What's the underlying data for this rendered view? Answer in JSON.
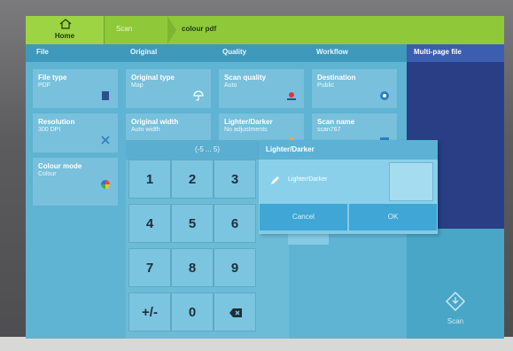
{
  "topbar": {
    "home_label": "Home",
    "crumb_scan": "Scan",
    "crumb_current": "colour pdf"
  },
  "columns": {
    "file": "File",
    "original": "Original",
    "quality": "Quality",
    "workflow": "Workflow"
  },
  "right_panel": {
    "title": "Multi-page file",
    "scan_label": "Scan"
  },
  "tiles": {
    "file_type": {
      "title": "File type",
      "value": "PDF",
      "icon": "document-icon"
    },
    "original_type": {
      "title": "Original type",
      "value": "Map",
      "icon": "umbrella-icon"
    },
    "scan_quality": {
      "title": "Scan quality",
      "value": "Auto",
      "icon": "quality-icon"
    },
    "destination": {
      "title": "Destination",
      "value": "Public",
      "icon": "location-pin-icon"
    },
    "resolution": {
      "title": "Resolution",
      "value": "300 DPI",
      "icon": "resize-arrows-icon"
    },
    "original_width": {
      "title": "Original width",
      "value": "Auto width"
    },
    "lighter_darker": {
      "title": "Lighter/Darker",
      "value": "No adjustments",
      "icon": "sun-icon"
    },
    "scan_name": {
      "title": "Scan name",
      "value": "scan767",
      "icon": "keyboard-icon"
    },
    "colour_mode": {
      "title": "Colour mode",
      "value": "Colour",
      "icon": "colour-wheel-icon"
    }
  },
  "keypad": {
    "range": "(-5 ... 5)",
    "keys": [
      "1",
      "2",
      "3",
      "4",
      "5",
      "6",
      "7",
      "8",
      "9",
      "+/-",
      "0"
    ],
    "backspace_icon": "backspace-icon"
  },
  "dialog": {
    "title": "Lighter/Darker",
    "field_label": "Lighter/Darker",
    "field_value": "",
    "cancel_label": "Cancel",
    "ok_label": "OK"
  },
  "colors": {
    "topbar": "#8fc93a",
    "screen": "#4aa6c7",
    "tile": "#78c0dc",
    "right_panel": "#2a3e86"
  }
}
